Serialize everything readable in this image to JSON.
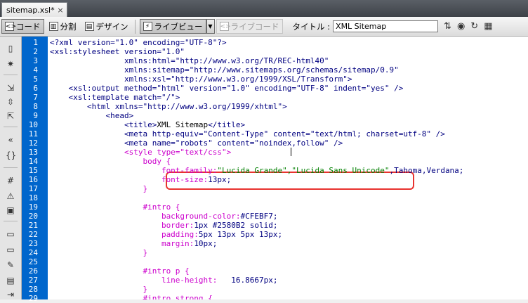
{
  "tab": {
    "title": "sitemap.xsl*",
    "close": "×"
  },
  "toolbar": {
    "code": "コード",
    "split": "分割",
    "design": "デザイン",
    "live_view": "ライブビュー",
    "live_code": "ライブコード",
    "title_label": "タイトル :",
    "title_value": "XML Sitemap"
  },
  "code_lines": [
    [
      [
        "t",
        "<?xml version=\"1.0\" encoding=\"UTF-8\"?>"
      ]
    ],
    [
      [
        "t",
        "<xsl:stylesheet version=\"1.0\""
      ]
    ],
    [
      [
        "t",
        "                xmlns:html=\"http://www.w3.org/TR/REC-html40\""
      ]
    ],
    [
      [
        "t",
        "                xmlns:sitemap=\"http://www.sitemaps.org/schemas/sitemap/0.9\""
      ]
    ],
    [
      [
        "t",
        "                xmlns:xsl=\"http://www.w3.org/1999/XSL/Transform\">"
      ]
    ],
    [
      [
        "t",
        "    <xsl:output method=\"html\" version=\"1.0\" encoding=\"UTF-8\" indent=\"yes\" />"
      ]
    ],
    [
      [
        "t",
        "    <xsl:template match=\"/\">"
      ]
    ],
    [
      [
        "t",
        "        <html xmlns=\"http://www.w3.org/1999/xhtml\">"
      ]
    ],
    [
      [
        "t",
        "            <head>"
      ]
    ],
    [
      [
        "t",
        "                <title>"
      ],
      [
        "n",
        "XML Sitemap"
      ],
      [
        "t",
        "</title>"
      ]
    ],
    [
      [
        "t",
        "                <meta http-equiv=\"Content-Type\" content=\"text/html; charset=utf-8\" />"
      ]
    ],
    [
      [
        "t",
        "                <meta name=\"robots\" content=\"noindex,follow\" />"
      ]
    ],
    [
      [
        "p",
        "                <style type=\"text/css\">"
      ]
    ],
    [
      [
        "p",
        "                    body {"
      ]
    ],
    [
      [
        "p",
        "                        font-family:"
      ],
      [
        "s",
        "\"Lucida Grande\",\"Lucida Sans Unicode\""
      ],
      [
        "v",
        ",Tahoma,Verdana;"
      ]
    ],
    [
      [
        "p",
        "                        font-size:"
      ],
      [
        "v",
        "13px;"
      ]
    ],
    [
      [
        "p",
        "                    }"
      ]
    ],
    [
      [
        "n",
        ""
      ]
    ],
    [
      [
        "p",
        "                    #intro {"
      ]
    ],
    [
      [
        "p",
        "                        background-color:"
      ],
      [
        "v",
        "#CFEBF7;"
      ]
    ],
    [
      [
        "p",
        "                        border:"
      ],
      [
        "v",
        "1px #2580B2 solid;"
      ]
    ],
    [
      [
        "p",
        "                        padding:"
      ],
      [
        "v",
        "5px 13px 5px 13px;"
      ]
    ],
    [
      [
        "p",
        "                        margin:"
      ],
      [
        "v",
        "10px;"
      ]
    ],
    [
      [
        "p",
        "                    }"
      ]
    ],
    [
      [
        "n",
        ""
      ]
    ],
    [
      [
        "p",
        "                    #intro p {"
      ]
    ],
    [
      [
        "p",
        "                        line-height:"
      ],
      [
        "v",
        "   16.8667px;"
      ]
    ],
    [
      [
        "p",
        "                    }"
      ]
    ],
    [
      [
        "p",
        "                    #intro strong {"
      ]
    ]
  ]
}
